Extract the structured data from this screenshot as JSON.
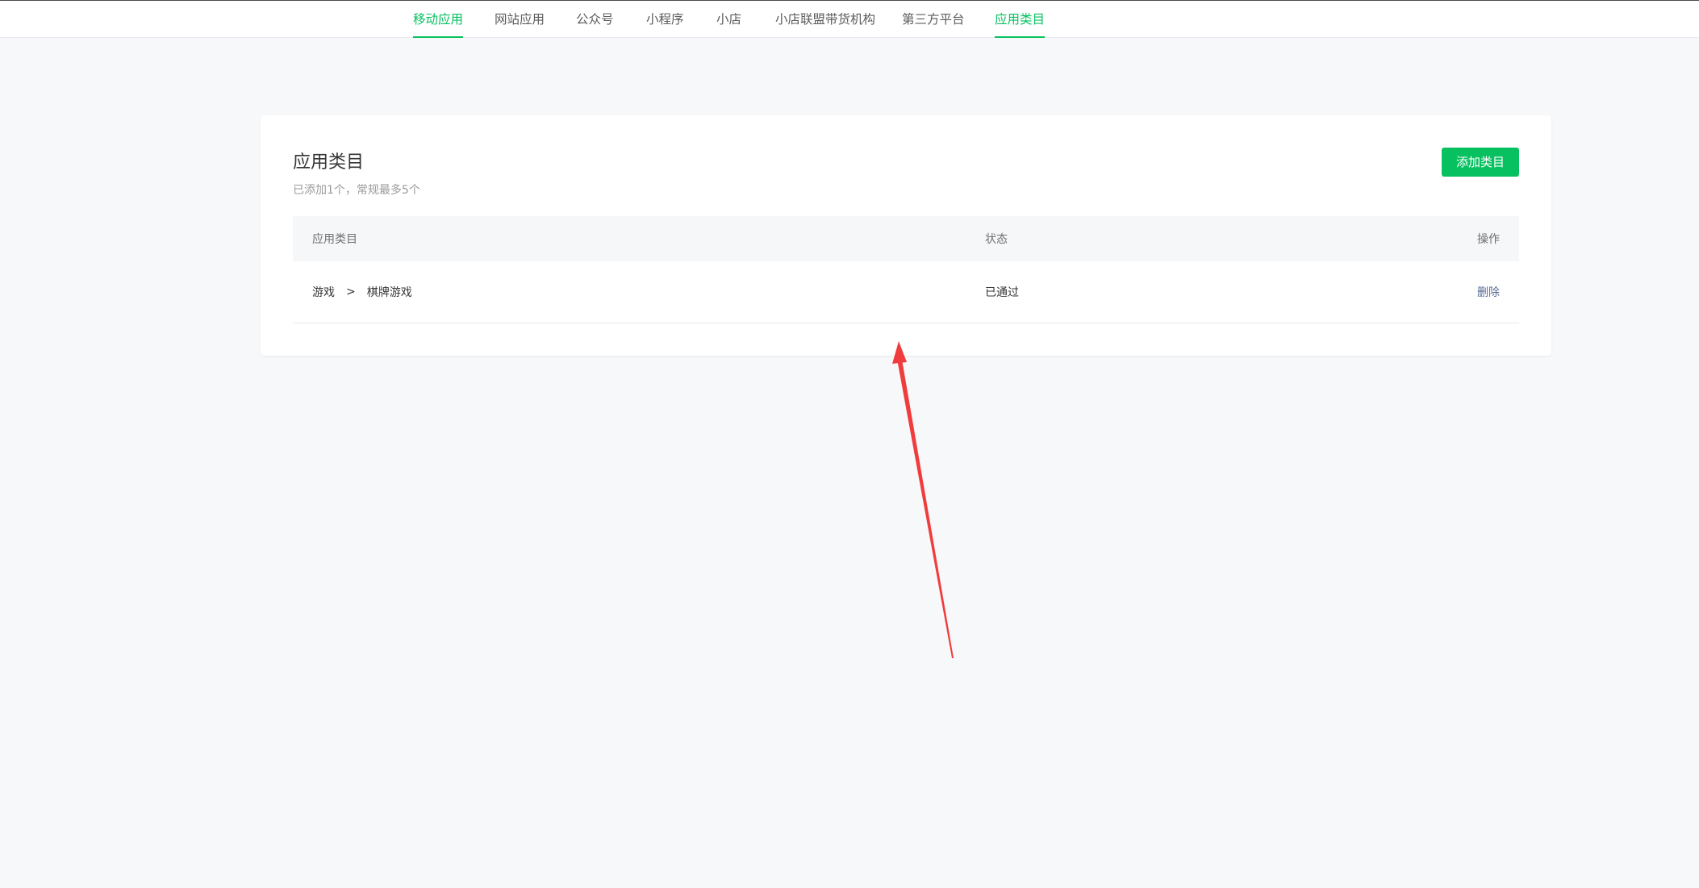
{
  "nav": {
    "tabs": [
      {
        "label": "移动应用"
      },
      {
        "label": "网站应用"
      },
      {
        "label": "公众号"
      },
      {
        "label": "小程序"
      },
      {
        "label": "小店"
      },
      {
        "label": "小店联盟带货机构"
      },
      {
        "label": "第三方平台"
      },
      {
        "label": "应用类目"
      }
    ]
  },
  "card": {
    "title": "应用类目",
    "description": "已添加1个，常规最多5个",
    "add_button": "添加类目"
  },
  "table": {
    "headers": {
      "category": "应用类目",
      "status": "状态",
      "operation": "操作"
    },
    "rows": [
      {
        "category_parent": "游戏",
        "separator": ">",
        "category_child": "棋牌游戏",
        "status": "已通过",
        "action": "删除"
      }
    ]
  },
  "colors": {
    "accent": "#07c160",
    "link": "#576b95",
    "annotation_arrow": "#f03c3c"
  }
}
